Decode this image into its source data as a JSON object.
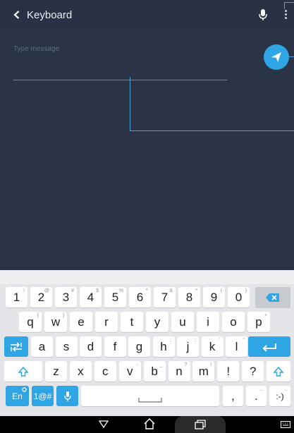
{
  "app_bar": {
    "title": "Keyboard",
    "icons": [
      "back-arrow-icon",
      "microphone-icon",
      "overflow-menu-icon"
    ]
  },
  "message": {
    "placeholder": "Type message",
    "send_icon": "send-icon"
  },
  "keyboard": {
    "number_row": [
      {
        "key": "1",
        "hint": "!"
      },
      {
        "key": "2",
        "hint": "@"
      },
      {
        "key": "3",
        "hint": "#"
      },
      {
        "key": "4",
        "hint": "$"
      },
      {
        "key": "5",
        "hint": "%"
      },
      {
        "key": "6",
        "hint": "^"
      },
      {
        "key": "7",
        "hint": "&"
      },
      {
        "key": "8",
        "hint": "*"
      },
      {
        "key": "9",
        "hint": "("
      },
      {
        "key": "0",
        "hint": ")"
      }
    ],
    "row_q": [
      {
        "key": "q",
        "hint": "["
      },
      {
        "key": "w",
        "hint": "]"
      },
      {
        "key": "e",
        "hint": ""
      },
      {
        "key": "r",
        "hint": ""
      },
      {
        "key": "t",
        "hint": ""
      },
      {
        "key": "y",
        "hint": ""
      },
      {
        "key": "u",
        "hint": ""
      },
      {
        "key": "i",
        "hint": ""
      },
      {
        "key": "o",
        "hint": ""
      },
      {
        "key": "p",
        "hint": "+"
      }
    ],
    "row_a": [
      {
        "key": "a",
        "hint": ""
      },
      {
        "key": "s",
        "hint": ""
      },
      {
        "key": "d",
        "hint": ""
      },
      {
        "key": "f",
        "hint": ""
      },
      {
        "key": "g",
        "hint": ""
      },
      {
        "key": "h",
        "hint": ";"
      },
      {
        "key": "j",
        "hint": ";"
      },
      {
        "key": "k",
        "hint": "'"
      },
      {
        "key": "l",
        "hint": "\""
      }
    ],
    "row_z": [
      {
        "key": "z",
        "hint": ""
      },
      {
        "key": "x",
        "hint": ""
      },
      {
        "key": "c",
        "hint": ""
      },
      {
        "key": "v",
        "hint": "-"
      },
      {
        "key": "b",
        "hint": "_"
      },
      {
        "key": "n",
        "hint": "?"
      },
      {
        "key": "m",
        "hint": "/"
      },
      {
        "key": "!",
        "hint": ""
      },
      {
        "key": "?",
        "hint": ""
      }
    ],
    "bottom_row": {
      "lang": "En",
      "symbols": "1@#",
      "comma": ",",
      "period": ".",
      "period_hint": "...",
      "emoticon": ":-)",
      "emoticon_hint": "..."
    },
    "accent_color": "#2fa6e3"
  },
  "nav_bar": {
    "icons": [
      "back-triangle-icon",
      "home-icon",
      "recents-icon",
      "keyboard-switch-icon"
    ]
  }
}
